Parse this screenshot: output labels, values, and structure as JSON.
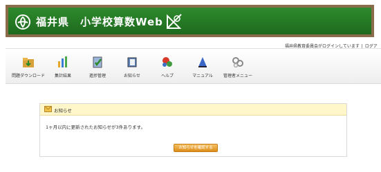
{
  "header": {
    "title": "福井県　小学校算数Web"
  },
  "login": {
    "status": "福井県教育委員会がログインしています",
    "separator": "|",
    "logout": "ログアウト"
  },
  "menu": [
    {
      "label": "問題ダウンロード",
      "icon": "folder-download-icon"
    },
    {
      "label": "集計結果",
      "icon": "bar-chart-icon"
    },
    {
      "label": "進捗管理",
      "icon": "clipboard-check-icon"
    },
    {
      "label": "お知らせ",
      "icon": "notebook-icon"
    },
    {
      "label": "ヘルプ",
      "icon": "help-gears-icon"
    },
    {
      "label": "マニュアル",
      "icon": "manual-book-icon"
    },
    {
      "label": "管理者メニュー",
      "icon": "admin-gears-icon"
    }
  ],
  "notice": {
    "title": "お知らせ",
    "message": "1ヶ月以内に更新されたお知らせが3件あります。",
    "button": "お知らせを確認する"
  },
  "colors": {
    "header_green": "#2a7f2a",
    "header_border": "#8a6b4a",
    "notice_bg": "#fff6c9",
    "button_orange": "#e9a23a"
  }
}
